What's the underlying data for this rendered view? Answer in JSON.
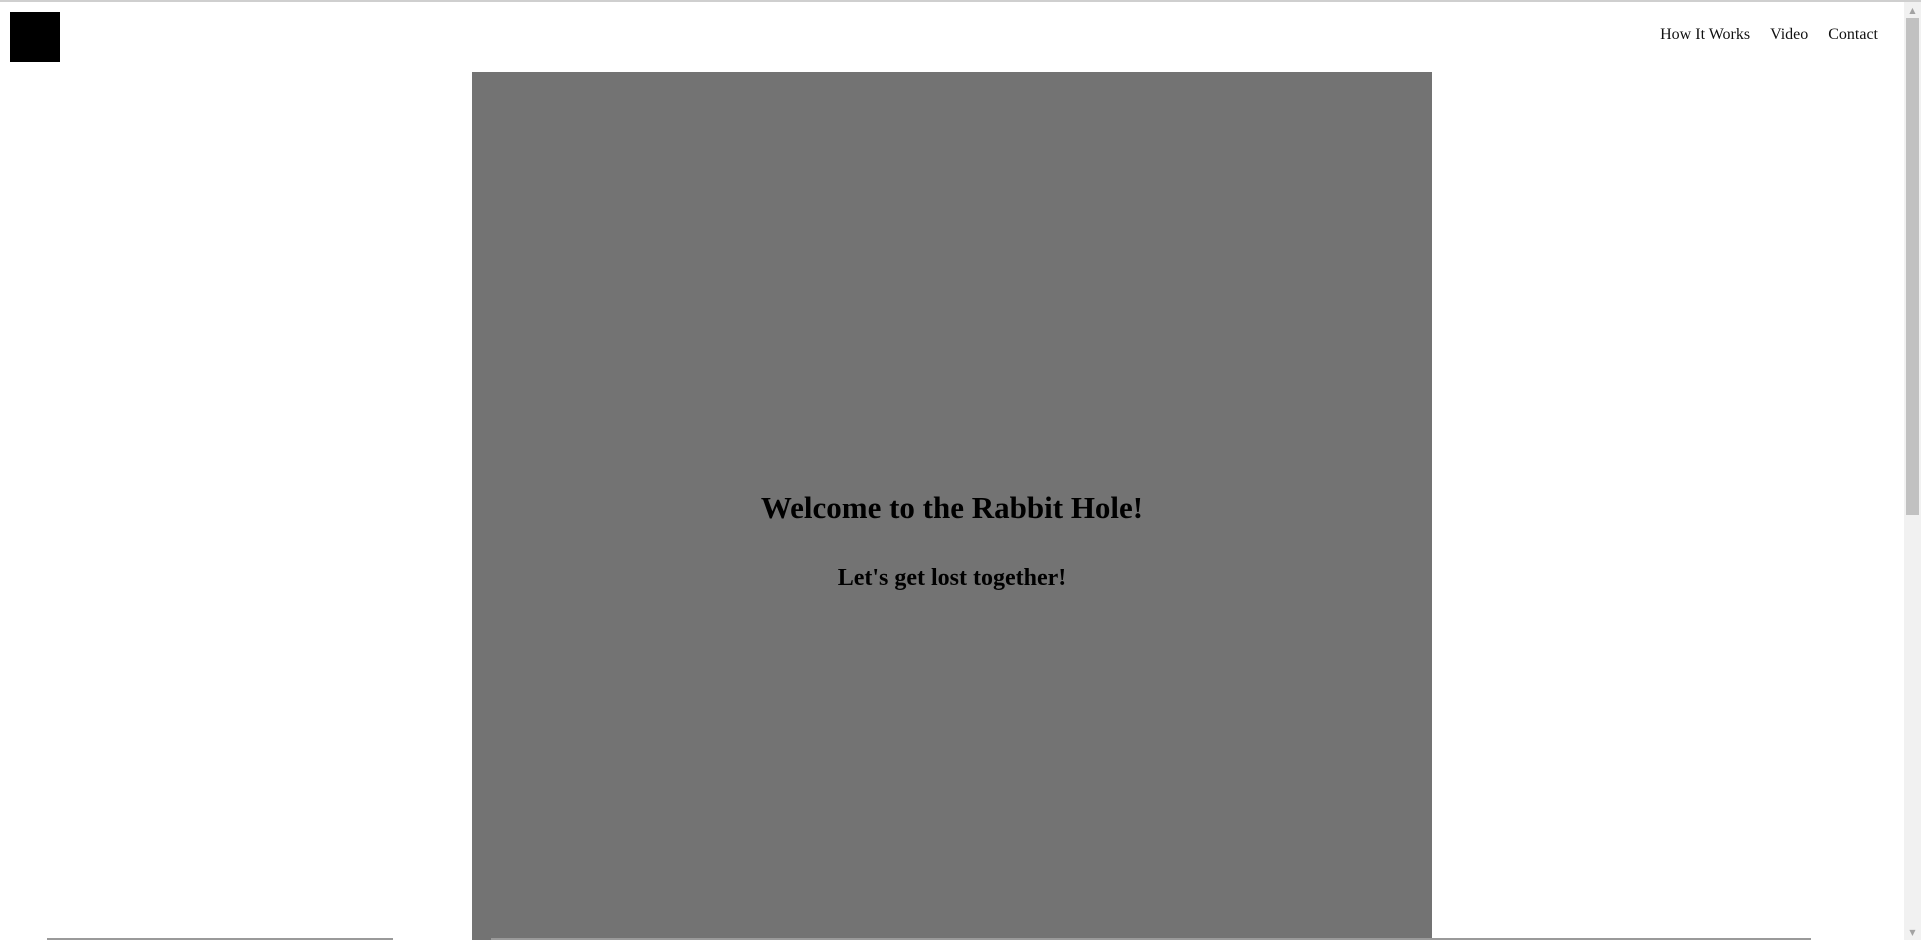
{
  "header": {
    "logo": "logo-block",
    "nav": [
      "How It Works",
      "Video",
      "Contact"
    ]
  },
  "hero": {
    "title": "Welcome to the Rabbit Hole!",
    "subtitle": "Let's get lost together!",
    "background_color": "#737373"
  },
  "scrollbar": {
    "up_icon": "triangle-up",
    "down_icon": "triangle-down",
    "up_glyph": "▲",
    "down_glyph": "▼"
  }
}
